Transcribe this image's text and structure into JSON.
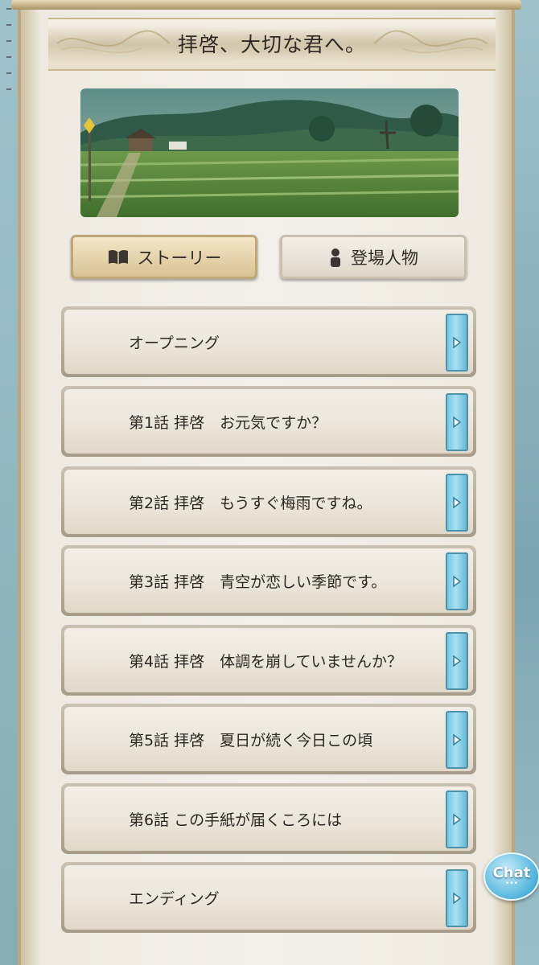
{
  "header": {
    "title": "拝啓、大切な君へ。"
  },
  "tabs": [
    {
      "label": "ストーリー",
      "icon": "book-icon",
      "active": true
    },
    {
      "label": "登場人物",
      "icon": "person-icon",
      "active": false
    }
  ],
  "episodes": [
    {
      "label": "オープニング"
    },
    {
      "label": "第1話 拝啓　お元気ですか？"
    },
    {
      "label": "第2話 拝啓　もうすぐ梅雨ですね。"
    },
    {
      "label": "第3話 拝啓　青空が恋しい季節です。"
    },
    {
      "label": "第4話 拝啓　体調を崩していませんか？"
    },
    {
      "label": "第5話 拝啓　夏日が続く今日この頃"
    },
    {
      "label": "第6話 この手紙が届くころには"
    },
    {
      "label": "エンディング"
    }
  ],
  "chat": {
    "label": "Chat"
  },
  "colors": {
    "accent": "#6fc1dc",
    "panel": "#f3f0ea",
    "tab_active": "#e6d3a8"
  }
}
